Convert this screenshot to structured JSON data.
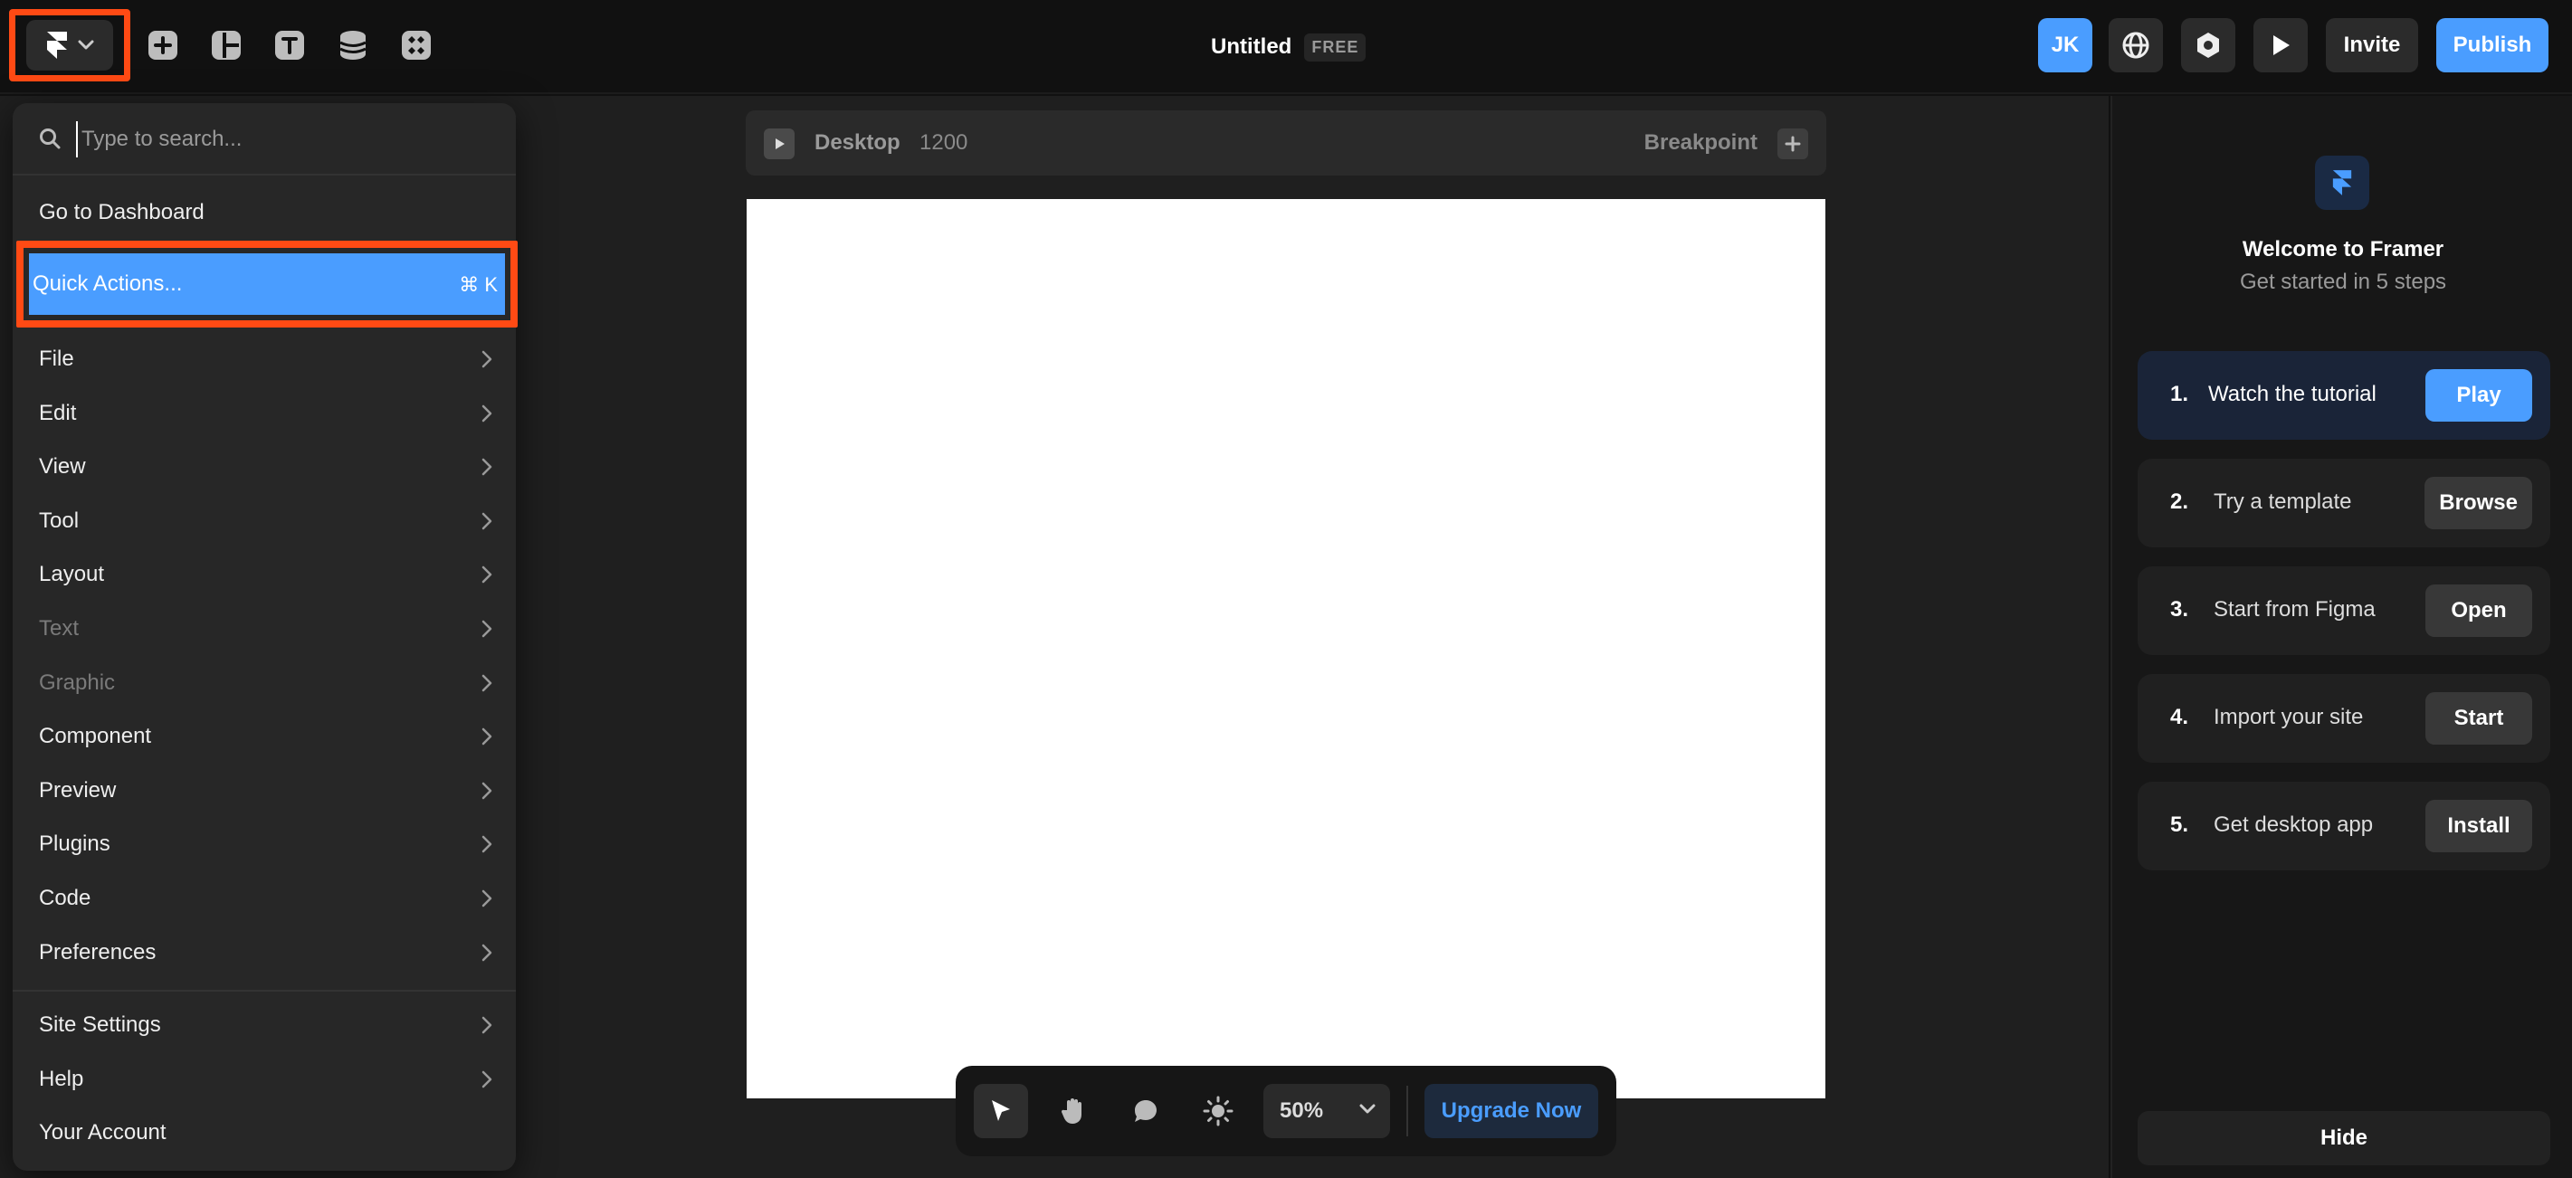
{
  "topbar": {
    "title": "Untitled",
    "plan_badge": "FREE",
    "avatar_initials": "JK",
    "invite_label": "Invite",
    "publish_label": "Publish",
    "tools": [
      "insert-icon",
      "layout-icon",
      "text-icon",
      "cms-icon",
      "components-icon"
    ]
  },
  "canvas": {
    "breakpoint_name": "Desktop",
    "breakpoint_width": "1200",
    "breakpoint_label": "Breakpoint"
  },
  "bottom_toolbar": {
    "zoom": "50%",
    "upgrade_label": "Upgrade Now"
  },
  "menu": {
    "search_placeholder": "Type to search...",
    "dashboard": "Go to Dashboard",
    "quick_actions": "Quick Actions...",
    "quick_actions_shortcut": "⌘ K",
    "items": [
      {
        "label": "File",
        "disabled": false
      },
      {
        "label": "Edit",
        "disabled": false
      },
      {
        "label": "View",
        "disabled": false
      },
      {
        "label": "Tool",
        "disabled": false
      },
      {
        "label": "Layout",
        "disabled": false
      },
      {
        "label": "Text",
        "disabled": true
      },
      {
        "label": "Graphic",
        "disabled": true
      },
      {
        "label": "Component",
        "disabled": false
      },
      {
        "label": "Preview",
        "disabled": false
      },
      {
        "label": "Plugins",
        "disabled": false
      },
      {
        "label": "Code",
        "disabled": false
      },
      {
        "label": "Preferences",
        "disabled": false
      }
    ],
    "footer_items": [
      "Site Settings",
      "Help",
      "Your Account"
    ]
  },
  "welcome": {
    "title": "Welcome to Framer",
    "subtitle": "Get started in 5 steps",
    "steps": [
      {
        "num": "1.",
        "label": "Watch the tutorial",
        "button": "Play"
      },
      {
        "num": "2.",
        "label": "Try a template",
        "button": "Browse"
      },
      {
        "num": "3.",
        "label": "Start from Figma",
        "button": "Open"
      },
      {
        "num": "4.",
        "label": "Import your site",
        "button": "Start"
      },
      {
        "num": "5.",
        "label": "Get desktop app",
        "button": "Install"
      }
    ],
    "hide_label": "Hide"
  },
  "colors": {
    "accent_blue": "#4a9dff",
    "highlight_orange": "#ff4a14"
  }
}
